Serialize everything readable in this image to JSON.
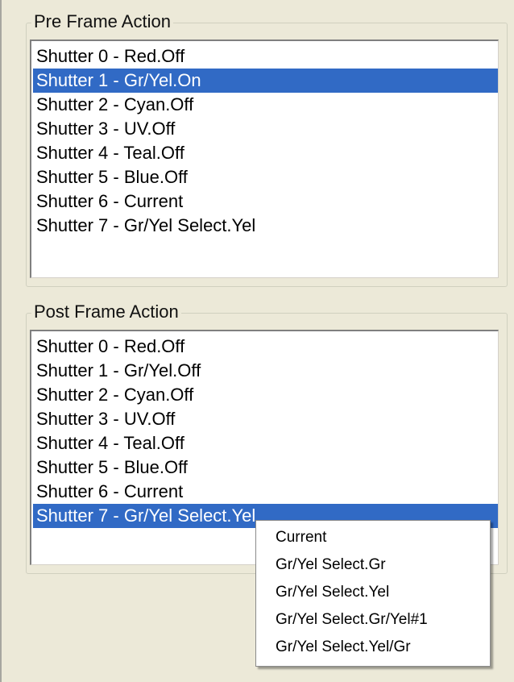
{
  "pre_frame": {
    "title": "Pre Frame Action",
    "selected_index": 1,
    "items": [
      "Shutter 0 - Red.Off",
      "Shutter 1 - Gr/Yel.On",
      "Shutter 2 - Cyan.Off",
      "Shutter 3 - UV.Off",
      "Shutter 4 - Teal.Off",
      "Shutter 5 - Blue.Off",
      "Shutter 6 - Current",
      "Shutter 7 - Gr/Yel Select.Yel"
    ]
  },
  "post_frame": {
    "title": "Post Frame Action",
    "selected_index": 7,
    "items": [
      "Shutter 0 - Red.Off",
      "Shutter 1 - Gr/Yel.Off",
      "Shutter 2 - Cyan.Off",
      "Shutter 3 - UV.Off",
      "Shutter 4 - Teal.Off",
      "Shutter 5 - Blue.Off",
      "Shutter 6 - Current",
      "Shutter 7 - Gr/Yel Select.Yel"
    ]
  },
  "context_menu": {
    "items": [
      "Current",
      "Gr/Yel Select.Gr",
      "Gr/Yel Select.Yel",
      "Gr/Yel Select.Gr/Yel#1",
      "Gr/Yel Select.Yel/Gr"
    ]
  },
  "colors": {
    "selection": "#316ac5",
    "panel_background": "#ece9d8"
  }
}
